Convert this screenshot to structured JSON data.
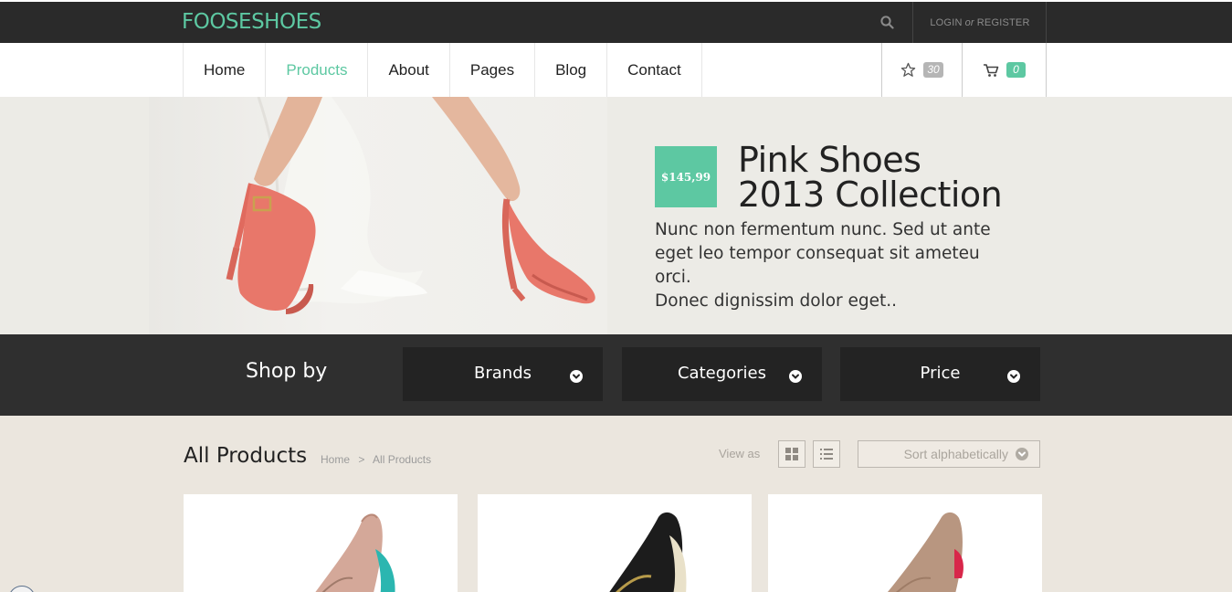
{
  "header": {
    "logo": "FOOSESHOES",
    "login": "LOGIN",
    "or": "or",
    "register": "REGISTER"
  },
  "nav": {
    "items": [
      {
        "label": "Home"
      },
      {
        "label": "Products",
        "active": true
      },
      {
        "label": "About"
      },
      {
        "label": "Pages"
      },
      {
        "label": "Blog"
      },
      {
        "label": "Contact"
      }
    ],
    "wishlist_count": "30",
    "cart_count": "0"
  },
  "hero": {
    "price": "$145,99",
    "title_line1": "Pink Shoes",
    "title_line2": "2013 Collection",
    "text_line1": "Nunc non fermentum nunc. Sed ut ante",
    "text_line2": "eget leo tempor consequat sit ameteu orci.",
    "text_line3": "Donec dignissim dolor eget.."
  },
  "shopby": {
    "label": "Shop by",
    "filters": [
      "Brands",
      "Categories",
      "Price"
    ]
  },
  "products": {
    "title": "All Products",
    "breadcrumb": [
      "Home",
      "All Products"
    ],
    "breadcrumb_sep": ">",
    "view_as": "View as",
    "sort": "Sort alphabetically"
  },
  "colors": {
    "accent": "#5dc8a2",
    "dark": "#2a2a2a",
    "background": "#ebe6de"
  },
  "icons": [
    "search-icon",
    "star-icon",
    "cart-icon",
    "chevron-down-icon",
    "grid-view-icon",
    "list-view-icon"
  ]
}
